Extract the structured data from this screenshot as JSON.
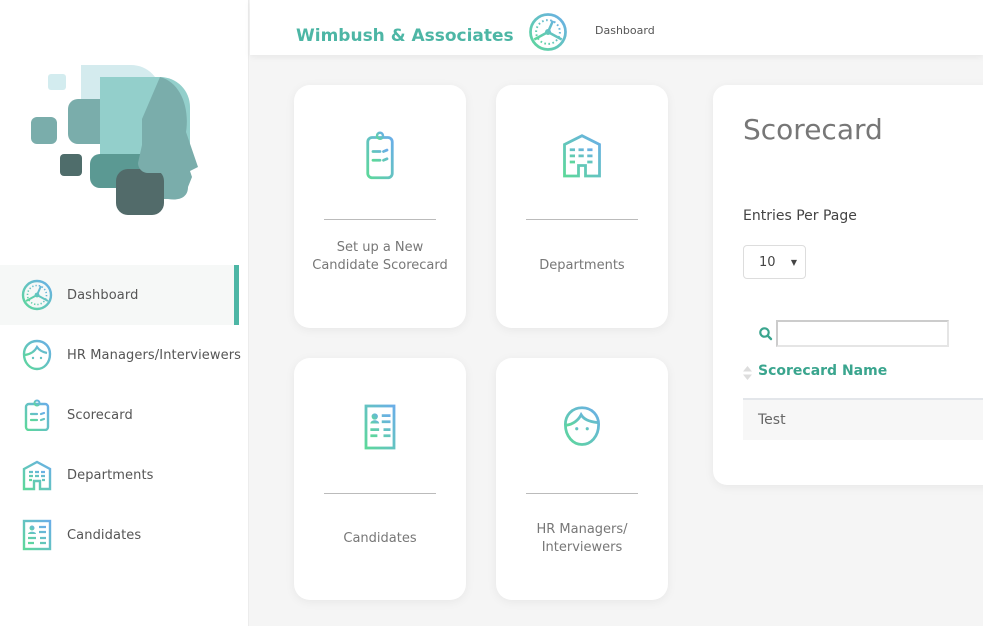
{
  "app": {
    "company_name": "Wimbush & Associates"
  },
  "colors": {
    "accent": "#4db6a5",
    "icon_gradient_start": "#5dd89a",
    "icon_gradient_end": "#6aaee8",
    "header_link": "#3aa58e"
  },
  "header": {
    "icon": "dashboard-gauge-icon",
    "breadcrumb": "Dashboard"
  },
  "sidebar": {
    "logo": "head-profile-logo",
    "items": [
      {
        "label": "Dashboard",
        "icon": "dashboard-gauge-icon",
        "active": true
      },
      {
        "label": "HR Managers/Interviewers",
        "icon": "person-face-icon",
        "active": false
      },
      {
        "label": "Scorecard",
        "icon": "clipboard-icon",
        "active": false
      },
      {
        "label": "Departments",
        "icon": "building-icon",
        "active": false
      },
      {
        "label": "Candidates",
        "icon": "id-card-icon",
        "active": false
      }
    ]
  },
  "tiles": [
    {
      "label": "Set up a New Candidate Scorecard",
      "icon": "clipboard-icon"
    },
    {
      "label": "Departments",
      "icon": "building-icon"
    },
    {
      "label": "Candidates",
      "icon": "id-card-icon"
    },
    {
      "label": "HR Managers/ Interviewers",
      "icon": "person-face-icon"
    }
  ],
  "scorecard_panel": {
    "title": "Scorecard",
    "entries_label": "Entries Per Page",
    "entries_value": "10",
    "search_value": "",
    "column_header": "Scorecard Name",
    "rows": [
      {
        "name": "Test"
      }
    ]
  }
}
